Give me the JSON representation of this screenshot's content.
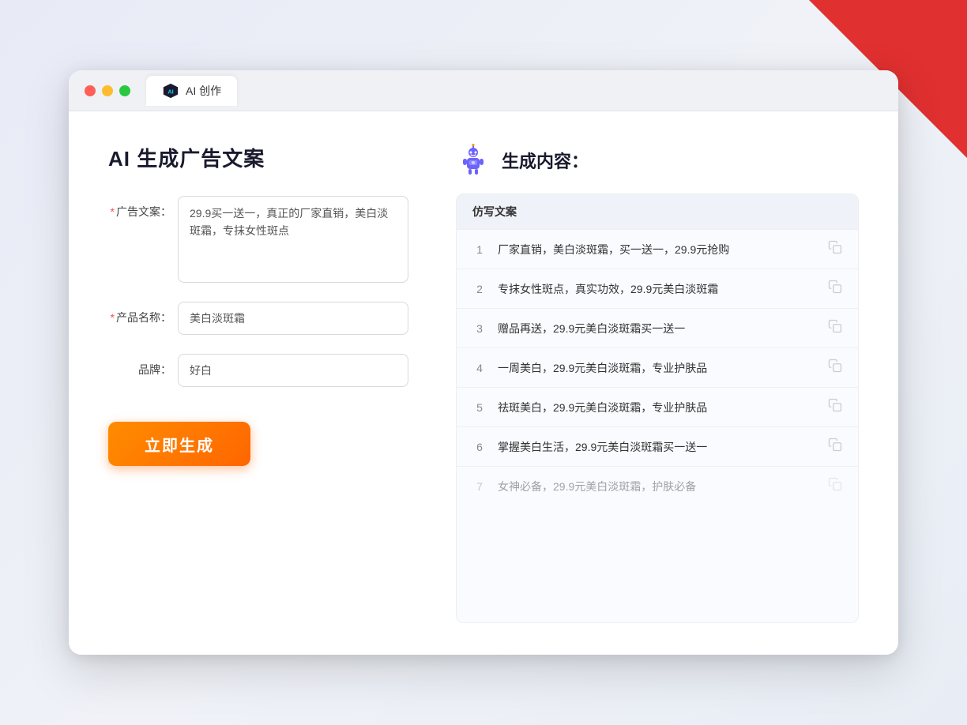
{
  "browser": {
    "tab_label": "AI 创作",
    "traffic_lights": [
      "red",
      "yellow",
      "green"
    ]
  },
  "left_panel": {
    "page_title": "AI 生成广告文案",
    "form": {
      "ad_copy_label": "广告文案：",
      "ad_copy_required": "*",
      "ad_copy_value": "29.9买一送一，真正的厂家直销，美白淡斑霜，专抹女性斑点",
      "product_name_label": "产品名称：",
      "product_name_required": "*",
      "product_name_value": "美白淡斑霜",
      "brand_label": "品牌：",
      "brand_value": "好白",
      "generate_button": "立即生成"
    }
  },
  "right_panel": {
    "title": "生成内容：",
    "table_header": "仿写文案",
    "results": [
      {
        "num": "1",
        "text": "厂家直销，美白淡斑霜，买一送一，29.9元抢购",
        "faded": false
      },
      {
        "num": "2",
        "text": "专抹女性斑点，真实功效，29.9元美白淡斑霜",
        "faded": false
      },
      {
        "num": "3",
        "text": "赠品再送，29.9元美白淡斑霜买一送一",
        "faded": false
      },
      {
        "num": "4",
        "text": "一周美白，29.9元美白淡斑霜，专业护肤品",
        "faded": false
      },
      {
        "num": "5",
        "text": "祛斑美白，29.9元美白淡斑霜，专业护肤品",
        "faded": false
      },
      {
        "num": "6",
        "text": "掌握美白生活，29.9元美白淡斑霜买一送一",
        "faded": false
      },
      {
        "num": "7",
        "text": "女神必备，29.9元美白淡斑霜，护肤必备",
        "faded": true
      }
    ]
  }
}
